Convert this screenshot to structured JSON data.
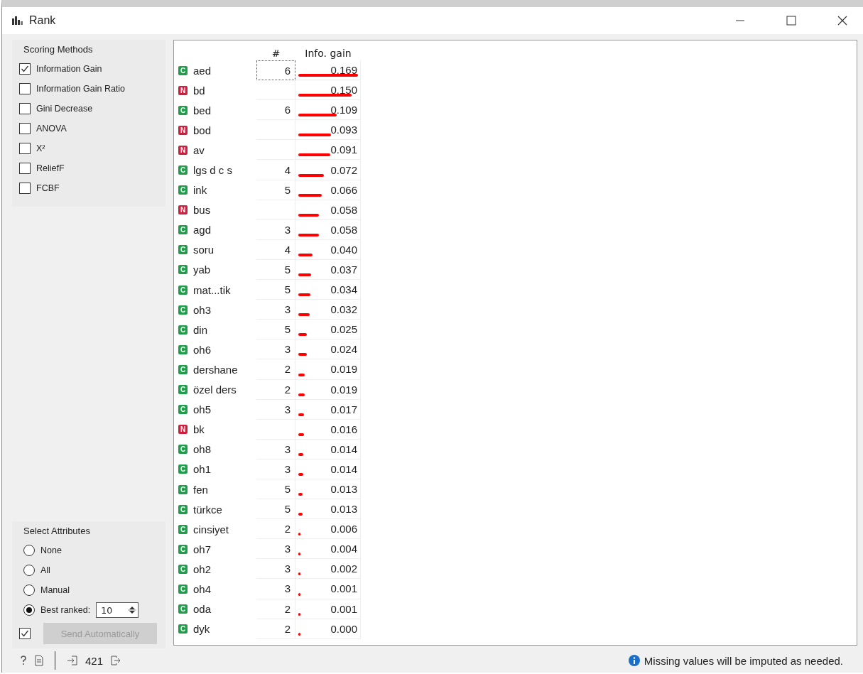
{
  "window": {
    "title": "Rank"
  },
  "scoring_methods": {
    "title": "Scoring Methods",
    "items": [
      {
        "label": "Information Gain",
        "checked": true
      },
      {
        "label": "Information Gain Ratio",
        "checked": false
      },
      {
        "label": "Gini Decrease",
        "checked": false
      },
      {
        "label": "ANOVA",
        "checked": false
      },
      {
        "label": "X²",
        "checked": false
      },
      {
        "label": "ReliefF",
        "checked": false
      },
      {
        "label": "FCBF",
        "checked": false
      }
    ]
  },
  "select_attributes": {
    "title": "Select Attributes",
    "options": [
      {
        "label": "None",
        "selected": false
      },
      {
        "label": "All",
        "selected": false
      },
      {
        "label": "Manual",
        "selected": false
      },
      {
        "label": "Best ranked:",
        "selected": true,
        "value": "10"
      }
    ]
  },
  "send_automatically": {
    "checked": true,
    "label": "Send Automatically",
    "disabled": true
  },
  "table": {
    "columns": [
      "#",
      "Info. gain"
    ],
    "rows": [
      {
        "kind": "categorical",
        "badge": "C",
        "name": "aed",
        "count": "6",
        "gain": "0.169",
        "level": 1.0,
        "focused": true
      },
      {
        "kind": "numeric",
        "badge": "N",
        "name": "bd",
        "count": "",
        "gain": "0.150",
        "level": 0.888,
        "focused": false
      },
      {
        "kind": "categorical",
        "badge": "C",
        "name": "bed",
        "count": "6",
        "gain": "0.109",
        "level": 0.645,
        "focused": false
      },
      {
        "kind": "numeric",
        "badge": "N",
        "name": "bod",
        "count": "",
        "gain": "0.093",
        "level": 0.55,
        "focused": false
      },
      {
        "kind": "numeric",
        "badge": "N",
        "name": "av",
        "count": "",
        "gain": "0.091",
        "level": 0.538,
        "focused": false
      },
      {
        "kind": "categorical",
        "badge": "C",
        "name": "lgs d c s",
        "count": "4",
        "gain": "0.072",
        "level": 0.426,
        "focused": false
      },
      {
        "kind": "categorical",
        "badge": "C",
        "name": "ink",
        "count": "5",
        "gain": "0.066",
        "level": 0.39,
        "focused": false
      },
      {
        "kind": "numeric",
        "badge": "N",
        "name": "bus",
        "count": "",
        "gain": "0.058",
        "level": 0.343,
        "focused": false
      },
      {
        "kind": "categorical",
        "badge": "C",
        "name": "agd",
        "count": "3",
        "gain": "0.058",
        "level": 0.343,
        "focused": false
      },
      {
        "kind": "categorical",
        "badge": "C",
        "name": "soru",
        "count": "4",
        "gain": "0.040",
        "level": 0.237,
        "focused": false
      },
      {
        "kind": "categorical",
        "badge": "C",
        "name": "yab",
        "count": "5",
        "gain": "0.037",
        "level": 0.219,
        "focused": false
      },
      {
        "kind": "categorical",
        "badge": "C",
        "name": "mat...tik",
        "count": "5",
        "gain": "0.034",
        "level": 0.201,
        "focused": false
      },
      {
        "kind": "categorical",
        "badge": "C",
        "name": "oh3",
        "count": "3",
        "gain": "0.032",
        "level": 0.189,
        "focused": false
      },
      {
        "kind": "categorical",
        "badge": "C",
        "name": "din",
        "count": "5",
        "gain": "0.025",
        "level": 0.148,
        "focused": false
      },
      {
        "kind": "categorical",
        "badge": "C",
        "name": "oh6",
        "count": "3",
        "gain": "0.024",
        "level": 0.142,
        "focused": false
      },
      {
        "kind": "categorical",
        "badge": "C",
        "name": "dershane",
        "count": "2",
        "gain": "0.019",
        "level": 0.112,
        "focused": false
      },
      {
        "kind": "categorical",
        "badge": "C",
        "name": "özel ders",
        "count": "2",
        "gain": "0.019",
        "level": 0.112,
        "focused": false
      },
      {
        "kind": "categorical",
        "badge": "C",
        "name": "oh5",
        "count": "3",
        "gain": "0.017",
        "level": 0.1,
        "focused": false
      },
      {
        "kind": "numeric",
        "badge": "N",
        "name": "bk",
        "count": "",
        "gain": "0.016",
        "level": 0.095,
        "focused": false
      },
      {
        "kind": "categorical",
        "badge": "C",
        "name": "oh8",
        "count": "3",
        "gain": "0.014",
        "level": 0.083,
        "focused": false
      },
      {
        "kind": "categorical",
        "badge": "C",
        "name": "oh1",
        "count": "3",
        "gain": "0.014",
        "level": 0.083,
        "focused": false
      },
      {
        "kind": "categorical",
        "badge": "C",
        "name": "fen",
        "count": "5",
        "gain": "0.013",
        "level": 0.077,
        "focused": false
      },
      {
        "kind": "categorical",
        "badge": "C",
        "name": "türkce",
        "count": "5",
        "gain": "0.013",
        "level": 0.077,
        "focused": false
      },
      {
        "kind": "categorical",
        "badge": "C",
        "name": "cinsiyet",
        "count": "2",
        "gain": "0.006",
        "level": 0.036,
        "focused": false
      },
      {
        "kind": "categorical",
        "badge": "C",
        "name": "oh7",
        "count": "3",
        "gain": "0.004",
        "level": 0.024,
        "focused": false
      },
      {
        "kind": "categorical",
        "badge": "C",
        "name": "oh2",
        "count": "3",
        "gain": "0.002",
        "level": 0.012,
        "focused": false
      },
      {
        "kind": "categorical",
        "badge": "C",
        "name": "oh4",
        "count": "3",
        "gain": "0.001",
        "level": 0.006,
        "focused": false
      },
      {
        "kind": "categorical",
        "badge": "C",
        "name": "oda",
        "count": "2",
        "gain": "0.001",
        "level": 0.006,
        "focused": false
      },
      {
        "kind": "categorical",
        "badge": "C",
        "name": "dyk",
        "count": "2",
        "gain": "0.000",
        "level": 0.0,
        "focused": false
      }
    ]
  },
  "status_bar": {
    "instances": "421",
    "message": "Missing values will be imputed as needed."
  }
}
